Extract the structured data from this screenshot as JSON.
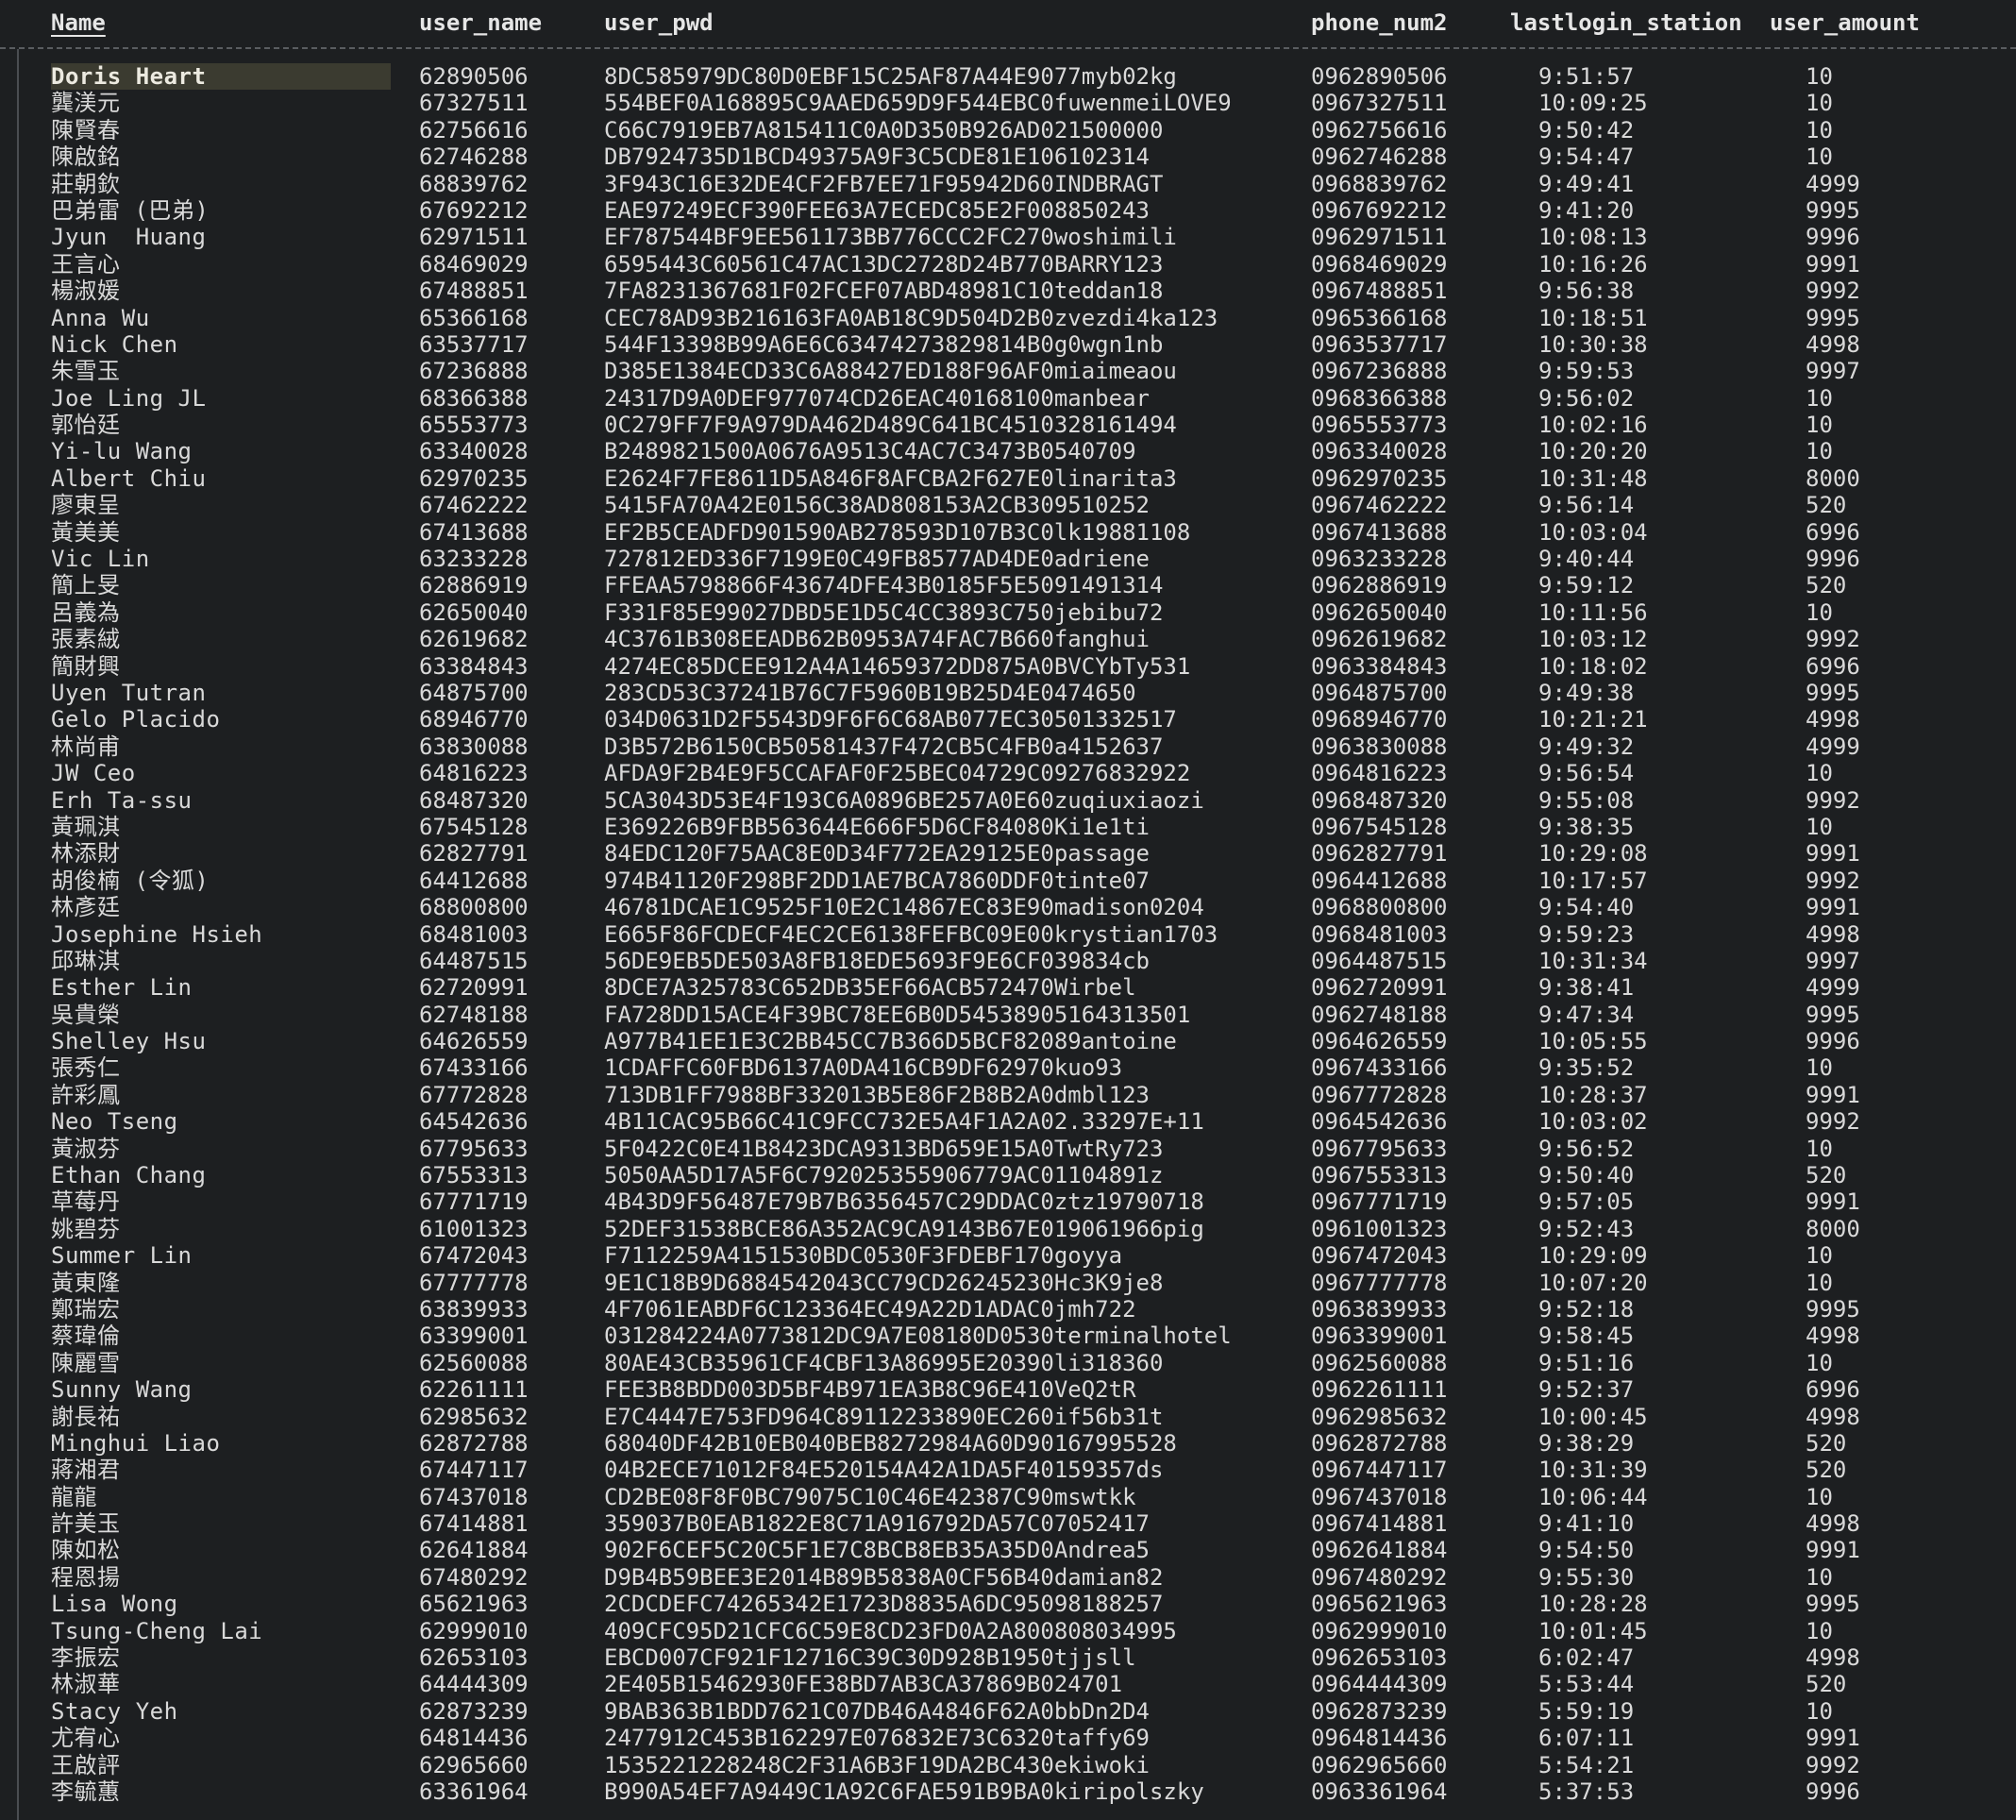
{
  "columns": {
    "name": "Name",
    "user_name": "user_name",
    "user_pwd": "user_pwd",
    "phone_num2": "phone_num2",
    "lastlogin_station": "lastlogin_station",
    "user_amount": "user_amount"
  },
  "rows": [
    {
      "name": "Doris Heart",
      "user_name": "62890506",
      "user_pwd": "8DC585979DC80D0EBF15C25AF87A44E9077myb02kg",
      "phone": "0962890506",
      "login": "9:51:57",
      "amount": "10"
    },
    {
      "name": "龔渼元",
      "user_name": "67327511",
      "user_pwd": "554BEF0A168895C9AAED659D9F544EBC0fuwenmeiLOVE9",
      "phone": "0967327511",
      "login": "10:09:25",
      "amount": "10"
    },
    {
      "name": "陳賢春",
      "user_name": "62756616",
      "user_pwd": "C66C7919EB7A815411C0A0D350B926AD021500000",
      "phone": "0962756616",
      "login": "9:50:42",
      "amount": "10"
    },
    {
      "name": "陳啟銘",
      "user_name": "62746288",
      "user_pwd": "DB7924735D1BCD49375A9F3C5CDE81E106102314",
      "phone": "0962746288",
      "login": "9:54:47",
      "amount": "10"
    },
    {
      "name": "莊朝欽",
      "user_name": "68839762",
      "user_pwd": "3F943C16E32DE4CF2FB7EE71F95942D60INDBRAGT",
      "phone": "0968839762",
      "login": "9:49:41",
      "amount": "4999"
    },
    {
      "name": "巴弟雷 (巴弟)",
      "user_name": "67692212",
      "user_pwd": "EAE97249ECF390FEE63A7ECEDC85E2F008850243",
      "phone": "0967692212",
      "login": "9:41:20",
      "amount": "9995"
    },
    {
      "name": "Jyun  Huang",
      "user_name": "62971511",
      "user_pwd": "EF787544BF9EE561173BB776CCC2FC270woshimili",
      "phone": "0962971511",
      "login": "10:08:13",
      "amount": "9996"
    },
    {
      "name": "王言心",
      "user_name": "68469029",
      "user_pwd": "6595443C60561C47AC13DC2728D24B770BARRY123",
      "phone": "0968469029",
      "login": "10:16:26",
      "amount": "9991"
    },
    {
      "name": "楊淑媛",
      "user_name": "67488851",
      "user_pwd": "7FA8231367681F02FCEF07ABD48981C10teddan18",
      "phone": "0967488851",
      "login": "9:56:38",
      "amount": "9992"
    },
    {
      "name": "Anna Wu",
      "user_name": "65366168",
      "user_pwd": "CEC78AD93B216163FA0AB18C9D504D2B0zvezdi4ka123",
      "phone": "0965366168",
      "login": "10:18:51",
      "amount": "9995"
    },
    {
      "name": "Nick Chen",
      "user_name": "63537717",
      "user_pwd": "544F13398B99A6E6C63474273829814B0g0wgn1nb",
      "phone": "0963537717",
      "login": "10:30:38",
      "amount": "4998"
    },
    {
      "name": "朱雪玉",
      "user_name": "67236888",
      "user_pwd": "D385E1384ECD33C6A88427ED188F96AF0miaimeaou",
      "phone": "0967236888",
      "login": "9:59:53",
      "amount": "9997"
    },
    {
      "name": "Joe Ling JL",
      "user_name": "68366388",
      "user_pwd": "24317D9A0DEF977074CD26EAC40168100manbear",
      "phone": "0968366388",
      "login": "9:56:02",
      "amount": "10"
    },
    {
      "name": "郭怡廷",
      "user_name": "65553773",
      "user_pwd": "0C279FF7F9A979DA462D489C641BC4510328161494",
      "phone": "0965553773",
      "login": "10:02:16",
      "amount": "10"
    },
    {
      "name": "Yi-lu Wang",
      "user_name": "63340028",
      "user_pwd": "B2489821500A0676A9513C4AC7C3473B0540709",
      "phone": "0963340028",
      "login": "10:20:20",
      "amount": "10"
    },
    {
      "name": "Albert Chiu",
      "user_name": "62970235",
      "user_pwd": "E2624F7FE8611D5A846F8AFCBA2F627E0linarita3",
      "phone": "0962970235",
      "login": "10:31:48",
      "amount": "8000"
    },
    {
      "name": "廖東呈",
      "user_name": "67462222",
      "user_pwd": "5415FA70A42E0156C38AD808153A2CB309510252",
      "phone": "0967462222",
      "login": "9:56:14",
      "amount": "520"
    },
    {
      "name": "黃美美",
      "user_name": "67413688",
      "user_pwd": "EF2B5CEADFD901590AB278593D107B3C0lk19881108",
      "phone": "0967413688",
      "login": "10:03:04",
      "amount": "6996"
    },
    {
      "name": "Vic Lin",
      "user_name": "63233228",
      "user_pwd": "727812ED336F7199E0C49FB8577AD4DE0adriene",
      "phone": "0963233228",
      "login": "9:40:44",
      "amount": "9996"
    },
    {
      "name": "簡上旻",
      "user_name": "62886919",
      "user_pwd": "FFEAA5798866F43674DFE43B0185F5E5091491314",
      "phone": "0962886919",
      "login": "9:59:12",
      "amount": "520"
    },
    {
      "name": "呂義為",
      "user_name": "62650040",
      "user_pwd": "F331F85E99027DBD5E1D5C4CC3893C750jebibu72",
      "phone": "0962650040",
      "login": "10:11:56",
      "amount": "10"
    },
    {
      "name": "張素絨",
      "user_name": "62619682",
      "user_pwd": "4C3761B308EEADB62B0953A74FAC7B660fanghui",
      "phone": "0962619682",
      "login": "10:03:12",
      "amount": "9992"
    },
    {
      "name": "簡財興",
      "user_name": "63384843",
      "user_pwd": "4274EC85DCEE912A4A14659372DD875A0BVCYbTy531",
      "phone": "0963384843",
      "login": "10:18:02",
      "amount": "6996"
    },
    {
      "name": "Uyen Tutran",
      "user_name": "64875700",
      "user_pwd": "283CD53C37241B76C7F5960B19B25D4E0474650",
      "phone": "0964875700",
      "login": "9:49:38",
      "amount": "9995"
    },
    {
      "name": "Gelo Placido",
      "user_name": "68946770",
      "user_pwd": "034D0631D2F5543D9F6F6C68AB077EC30501332517",
      "phone": "0968946770",
      "login": "10:21:21",
      "amount": "4998"
    },
    {
      "name": "林尚甫",
      "user_name": "63830088",
      "user_pwd": "D3B572B6150CB50581437F472CB5C4FB0a4152637",
      "phone": "0963830088",
      "login": "9:49:32",
      "amount": "4999"
    },
    {
      "name": "JW Ceo",
      "user_name": "64816223",
      "user_pwd": "AFDA9F2B4E9F5CCAFAF0F25BEC04729C09276832922",
      "phone": "0964816223",
      "login": "9:56:54",
      "amount": "10"
    },
    {
      "name": "Erh Ta-ssu",
      "user_name": "68487320",
      "user_pwd": "5CA3043D53E4F193C6A0896BE257A0E60zuqiuxiaozi",
      "phone": "0968487320",
      "login": "9:55:08",
      "amount": "9992"
    },
    {
      "name": "黃珮淇",
      "user_name": "67545128",
      "user_pwd": "E369226B9FBB563644E666F5D6CF84080Ki1e1ti",
      "phone": "0967545128",
      "login": "9:38:35",
      "amount": "10"
    },
    {
      "name": "林添財",
      "user_name": "62827791",
      "user_pwd": "84EDC120F75AAC8E0D34F772EA29125E0passage",
      "phone": "0962827791",
      "login": "10:29:08",
      "amount": "9991"
    },
    {
      "name": "胡俊楠 (令狐)",
      "user_name": "64412688",
      "user_pwd": "974B41120F298BF2DD1AE7BCA7860DDF0tinte07",
      "phone": "0964412688",
      "login": "10:17:57",
      "amount": "9992"
    },
    {
      "name": "林彥廷",
      "user_name": "68800800",
      "user_pwd": "46781DCAE1C9525F10E2C14867EC83E90madison0204",
      "phone": "0968800800",
      "login": "9:54:40",
      "amount": "9991"
    },
    {
      "name": "Josephine Hsieh",
      "user_name": "68481003",
      "user_pwd": "E665F86FCDECF4EC2CE6138FEFBC09E00krystian1703",
      "phone": "0968481003",
      "login": "9:59:23",
      "amount": "4998"
    },
    {
      "name": "邱琳淇",
      "user_name": "64487515",
      "user_pwd": "56DE9EB5DE503A8FB18EDE5693F9E6CF039834cb",
      "phone": "0964487515",
      "login": "10:31:34",
      "amount": "9997"
    },
    {
      "name": "Esther Lin",
      "user_name": "62720991",
      "user_pwd": "8DCE7A325783C652DB35EF66ACB572470Wirbel",
      "phone": "0962720991",
      "login": "9:38:41",
      "amount": "4999"
    },
    {
      "name": "吳貴榮",
      "user_name": "62748188",
      "user_pwd": "FA728DD15ACE4F39BC78EE6B0D54538905164313501",
      "phone": "0962748188",
      "login": "9:47:34",
      "amount": "9995"
    },
    {
      "name": "Shelley Hsu",
      "user_name": "64626559",
      "user_pwd": "A977B41EE1E3C2BB45CC7B366D5BCF82089antoine",
      "phone": "0964626559",
      "login": "10:05:55",
      "amount": "9996"
    },
    {
      "name": "張秀仁",
      "user_name": "67433166",
      "user_pwd": "1CDAFFC60FBD6137A0DA416CB9DF62970kuo93",
      "phone": "0967433166",
      "login": "9:35:52",
      "amount": "10"
    },
    {
      "name": "許彩鳳",
      "user_name": "67772828",
      "user_pwd": "713DB1FF7988BF332013B5E86F2B8B2A0dmbl123",
      "phone": "0967772828",
      "login": "10:28:37",
      "amount": "9991"
    },
    {
      "name": "Neo Tseng",
      "user_name": "64542636",
      "user_pwd": "4B11CAC95B66C41C9FCC732E5A4F1A2A02.33297E+11",
      "phone": "0964542636",
      "login": "10:03:02",
      "amount": "9992"
    },
    {
      "name": "黃淑芬",
      "user_name": "67795633",
      "user_pwd": "5F0422C0E41B8423DCA9313BD659E15A0TwtRy723",
      "phone": "0967795633",
      "login": "9:56:52",
      "amount": "10"
    },
    {
      "name": "Ethan Chang",
      "user_name": "67553313",
      "user_pwd": "5050AA5D17A5F6C792025355906779AC01104891z",
      "phone": "0967553313",
      "login": "9:50:40",
      "amount": "520"
    },
    {
      "name": "草莓丹",
      "user_name": "67771719",
      "user_pwd": "4B43D9F56487E79B7B6356457C29DDAC0ztz19790718",
      "phone": "0967771719",
      "login": "9:57:05",
      "amount": "9991"
    },
    {
      "name": "姚碧芬",
      "user_name": "61001323",
      "user_pwd": "52DEF31538BCE86A352AC9CA9143B67E019061966pig",
      "phone": "0961001323",
      "login": "9:52:43",
      "amount": "8000"
    },
    {
      "name": "Summer Lin",
      "user_name": "67472043",
      "user_pwd": "F7112259A4151530BDC0530F3FDEBF170goyya",
      "phone": "0967472043",
      "login": "10:29:09",
      "amount": "10"
    },
    {
      "name": "黃東隆",
      "user_name": "67777778",
      "user_pwd": "9E1C18B9D6884542043CC79CD26245230Hc3K9je8",
      "phone": "0967777778",
      "login": "10:07:20",
      "amount": "10"
    },
    {
      "name": "鄭瑞宏",
      "user_name": "63839933",
      "user_pwd": "4F7061EABDF6C123364EC49A22D1ADAC0jmh722",
      "phone": "0963839933",
      "login": "9:52:18",
      "amount": "9995"
    },
    {
      "name": "蔡瑋倫",
      "user_name": "63399001",
      "user_pwd": "031284224A0773812DC9A7E08180D0530terminalhotel",
      "phone": "0963399001",
      "login": "9:58:45",
      "amount": "4998"
    },
    {
      "name": "陳麗雪",
      "user_name": "62560088",
      "user_pwd": "80AE43CB35961CF4CBF13A86995E20390li318360",
      "phone": "0962560088",
      "login": "9:51:16",
      "amount": "10"
    },
    {
      "name": "Sunny Wang",
      "user_name": "62261111",
      "user_pwd": "FEE3B8BDD003D5BF4B971EA3B8C96E410VeQ2tR",
      "phone": "0962261111",
      "login": "9:52:37",
      "amount": "6996"
    },
    {
      "name": "謝長祐",
      "user_name": "62985632",
      "user_pwd": "E7C4447E753FD964C89112233890EC260if56b31t",
      "phone": "0962985632",
      "login": "10:00:45",
      "amount": "4998"
    },
    {
      "name": "Minghui Liao",
      "user_name": "62872788",
      "user_pwd": "68040DF42B10EB040BEB8272984A60D90167995528",
      "phone": "0962872788",
      "login": "9:38:29",
      "amount": "520"
    },
    {
      "name": "蔣湘君",
      "user_name": "67447117",
      "user_pwd": "04B2ECE71012F84E520154A42A1DA5F40159357ds",
      "phone": "0967447117",
      "login": "10:31:39",
      "amount": "520"
    },
    {
      "name": "龍龍",
      "user_name": "67437018",
      "user_pwd": "CD2BE08F8F0BC79075C10C46E42387C90mswtkk",
      "phone": "0967437018",
      "login": "10:06:44",
      "amount": "10"
    },
    {
      "name": "許美玉",
      "user_name": "67414881",
      "user_pwd": "359037B0EAB1822E8C71A916792DA57C07052417",
      "phone": "0967414881",
      "login": "9:41:10",
      "amount": "4998"
    },
    {
      "name": "陳如松",
      "user_name": "62641884",
      "user_pwd": "902F6CEF5C20C5F1E7C8BCB8EB35A35D0Andrea5",
      "phone": "0962641884",
      "login": "9:54:50",
      "amount": "9991"
    },
    {
      "name": "程恩揚",
      "user_name": "67480292",
      "user_pwd": "D9B4B59BEE3E2014B89B5838A0CF56B40damian82",
      "phone": "0967480292",
      "login": "9:55:30",
      "amount": "10"
    },
    {
      "name": "Lisa Wong",
      "user_name": "65621963",
      "user_pwd": "2CDCDEFC74265342E1723D8835A6DC95098188257",
      "phone": "0965621963",
      "login": "10:28:28",
      "amount": "9995"
    },
    {
      "name": "Tsung-Cheng Lai",
      "user_name": "62999010",
      "user_pwd": "409CFC95D21CFC6C59E8CD23FD0A2A800808034995",
      "phone": "0962999010",
      "login": "10:01:45",
      "amount": "10"
    },
    {
      "name": "李振宏",
      "user_name": "62653103",
      "user_pwd": "EBCD007CF921F12716C39C30D928B1950tjjsll",
      "phone": "0962653103",
      "login": "6:02:47",
      "amount": "4998"
    },
    {
      "name": "林淑華",
      "user_name": "64444309",
      "user_pwd": "2E405B15462930FE38BD7AB3CA37869B024701",
      "phone": "0964444309",
      "login": "5:53:44",
      "amount": "520"
    },
    {
      "name": "Stacy Yeh",
      "user_name": "62873239",
      "user_pwd": "9BAB363B1BDD7621C07DB46A4846F62A0bbDn2D4",
      "phone": "0962873239",
      "login": "5:59:19",
      "amount": "10"
    },
    {
      "name": "尤宥心",
      "user_name": "64814436",
      "user_pwd": "2477912C453B162297E076832E73C6320taffy69",
      "phone": "0964814436",
      "login": "6:07:11",
      "amount": "9991"
    },
    {
      "name": "王啟評",
      "user_name": "62965660",
      "user_pwd": "1535221228248C2F31A6B3F19DA2BC430ekiwoki",
      "phone": "0962965660",
      "login": "5:54:21",
      "amount": "9992"
    },
    {
      "name": "李毓蕙",
      "user_name": "63361964",
      "user_pwd": "B990A54EF7A9449C1A92C6FAE591B9BA0kiripolszky",
      "phone": "0963361964",
      "login": "5:37:53",
      "amount": "9996"
    }
  ]
}
